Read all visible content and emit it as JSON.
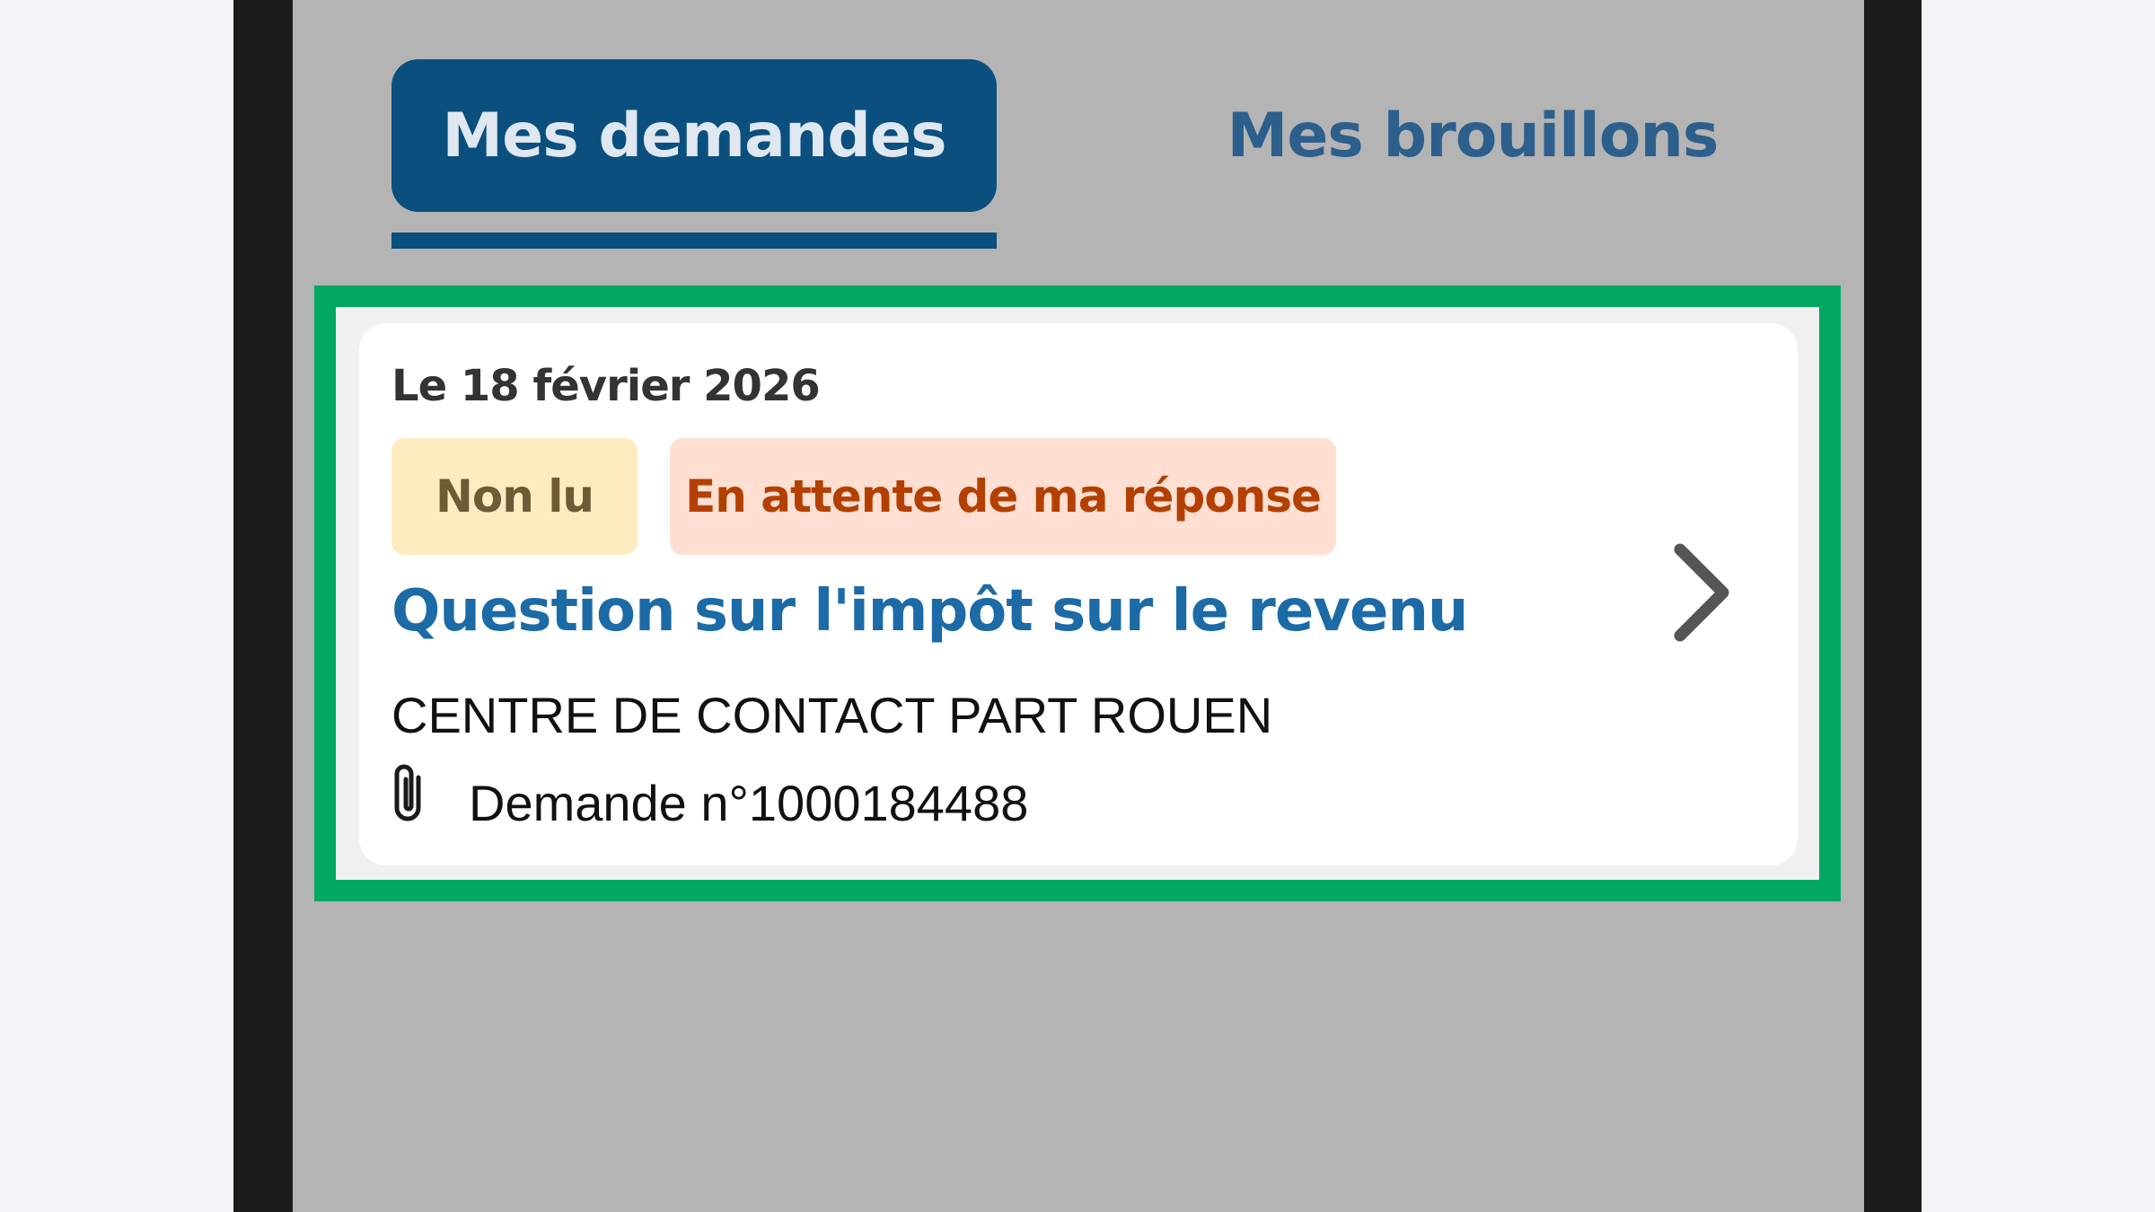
{
  "tabs": [
    {
      "label": "Mes demandes",
      "active": true
    },
    {
      "label": "Mes brouillons",
      "active": false
    }
  ],
  "request": {
    "date": "Le 18 février 2026",
    "badges": [
      {
        "label": "Non lu",
        "kind": "unread"
      },
      {
        "label": "En attente de ma réponse",
        "kind": "status"
      }
    ],
    "subject": "Question sur l'impôt sur le revenu",
    "sender": "CENTRE DE CONTACT PART ROUEN",
    "reference": "Demande n°1000184488",
    "icons": {
      "attachment": "paperclip-icon",
      "open": "chevron-right-icon"
    }
  },
  "colors": {
    "primary": "#0a4f7e",
    "highlight": "#00a862",
    "link": "#1c6aa6",
    "unread_bg": "#feecc0",
    "status_bg": "#fedfd2",
    "status_text": "#b34000"
  }
}
